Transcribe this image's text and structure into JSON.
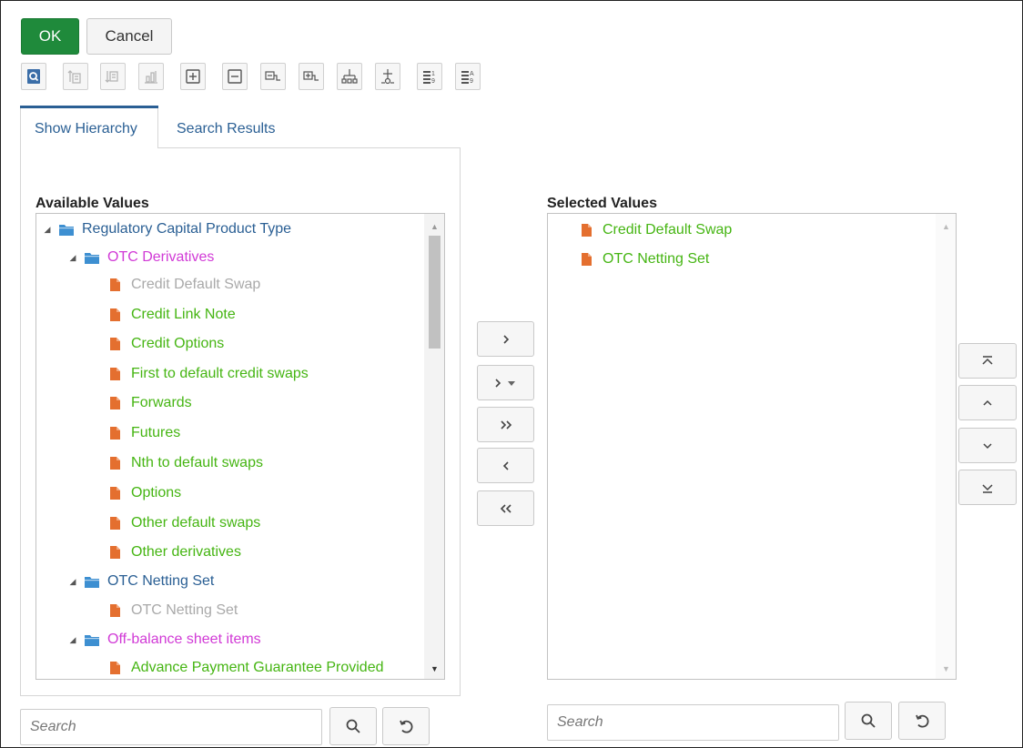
{
  "buttons": {
    "ok": "OK",
    "cancel": "Cancel"
  },
  "toolbar": {
    "icons": [
      "find-icon",
      "move-up-icon",
      "move-down-icon",
      "level-icon",
      "expand-icon",
      "collapse-icon",
      "expand-branch-icon",
      "collapse-branch-icon",
      "show-hierarchy-icon",
      "focus-icon",
      "sort-code-icon",
      "sort-alpha-icon"
    ]
  },
  "tabs": [
    {
      "label": "Show Hierarchy",
      "active": true
    },
    {
      "label": "Search Results",
      "active": false
    }
  ],
  "available": {
    "heading": "Available Values",
    "items": [
      {
        "label": "Regulatory Capital Product Type",
        "type": "folder",
        "level": 0,
        "color": "blue"
      },
      {
        "label": "OTC Derivatives",
        "type": "folder",
        "level": 1,
        "color": "pink"
      },
      {
        "label": "Credit Default Swap",
        "type": "leaf",
        "level": 2,
        "color": "gray"
      },
      {
        "label": "Credit Link Note",
        "type": "leaf",
        "level": 2,
        "color": "green"
      },
      {
        "label": "Credit Options",
        "type": "leaf",
        "level": 2,
        "color": "green"
      },
      {
        "label": "First to default credit swaps",
        "type": "leaf",
        "level": 2,
        "color": "green"
      },
      {
        "label": "Forwards",
        "type": "leaf",
        "level": 2,
        "color": "green"
      },
      {
        "label": "Futures",
        "type": "leaf",
        "level": 2,
        "color": "green"
      },
      {
        "label": "Nth to default swaps",
        "type": "leaf",
        "level": 2,
        "color": "green"
      },
      {
        "label": "Options",
        "type": "leaf",
        "level": 2,
        "color": "green"
      },
      {
        "label": "Other default swaps",
        "type": "leaf",
        "level": 2,
        "color": "green"
      },
      {
        "label": "Other derivatives",
        "type": "leaf",
        "level": 2,
        "color": "green"
      },
      {
        "label": "OTC Netting Set",
        "type": "folder",
        "level": 1,
        "color": "blue"
      },
      {
        "label": "OTC Netting Set",
        "type": "leaf",
        "level": 2,
        "color": "gray"
      },
      {
        "label": "Off-balance sheet items",
        "type": "folder",
        "level": 1,
        "color": "pink"
      },
      {
        "label": "Advance Payment Guarantee Provided",
        "type": "leaf",
        "level": 2,
        "color": "green"
      }
    ]
  },
  "selected": {
    "heading": "Selected Values",
    "items": [
      {
        "label": "Credit Default Swap",
        "color": "green"
      },
      {
        "label": "OTC Netting Set",
        "color": "green"
      }
    ]
  },
  "shuttle_buttons": [
    "move-right",
    "move-selected-dropdown",
    "move-all-right",
    "move-left",
    "move-all-left"
  ],
  "order_buttons": [
    "move-to-top",
    "move-up",
    "move-down",
    "move-to-bottom"
  ],
  "search_left": {
    "placeholder": "Search"
  },
  "search_right": {
    "placeholder": "Search"
  },
  "colors": {
    "ok": "#1f8a3b",
    "blue": "#2a5f94",
    "pink": "#d13ad6",
    "green": "#45b512",
    "gray": "#a9a9a9",
    "folder": "#3d8fd1",
    "leaf": "#e46f2f"
  }
}
